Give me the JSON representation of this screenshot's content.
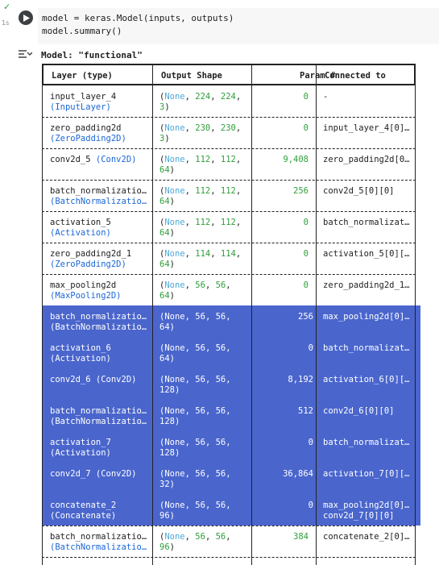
{
  "cell": {
    "status": "✓",
    "exec_time": "1s",
    "code_lines": [
      "model = keras.Model(inputs, outputs)",
      "model.summary()"
    ]
  },
  "output": {
    "title": "Model: \"functional\""
  },
  "table": {
    "headers": [
      "Layer (type)",
      "Output Shape",
      "Param #",
      "Connected to"
    ],
    "rows": [
      {
        "name": "input_layer_4",
        "type": "(InputLayer)",
        "shape": [
          "(None, 224, 224,",
          "3)"
        ],
        "params": "0",
        "conn": [
          "-"
        ],
        "selected": false
      },
      {
        "name": "zero_padding2d",
        "type": "(ZeroPadding2D)",
        "shape": [
          "(None, 230, 230,",
          "3)"
        ],
        "params": "0",
        "conn": [
          "input_layer_4[0]…"
        ],
        "selected": false
      },
      {
        "name": "conv2d_5",
        "type": "(Conv2D)",
        "shape": [
          "(None, 112, 112,",
          "64)"
        ],
        "params": "9,408",
        "conn": [
          "zero_padding2d[0…"
        ],
        "selected": false,
        "inline_type": true
      },
      {
        "name": "batch_normalizatio…",
        "type": "(BatchNormalizatio…",
        "shape": [
          "(None, 112, 112,",
          "64)"
        ],
        "params": "256",
        "conn": [
          "conv2d_5[0][0]"
        ],
        "selected": false
      },
      {
        "name": "activation_5",
        "type": "(Activation)",
        "shape": [
          "(None, 112, 112,",
          "64)"
        ],
        "params": "0",
        "conn": [
          "batch_normalizat…"
        ],
        "selected": false
      },
      {
        "name": "zero_padding2d_1",
        "type": "(ZeroPadding2D)",
        "shape": [
          "(None, 114, 114,",
          "64)"
        ],
        "params": "0",
        "conn": [
          "activation_5[0][…"
        ],
        "selected": false
      },
      {
        "name": "max_pooling2d",
        "type": "(MaxPooling2D)",
        "shape": [
          "(None, 56, 56,",
          "64)"
        ],
        "params": "0",
        "conn": [
          "zero_padding2d_1…"
        ],
        "selected": false
      },
      {
        "name": "batch_normalizatio…",
        "type": "(BatchNormalizatio…",
        "shape": [
          "(None, 56, 56,",
          "64)"
        ],
        "params": "256",
        "conn": [
          "max_pooling2d[0]…"
        ],
        "selected": true
      },
      {
        "name": "activation_6",
        "type": "(Activation)",
        "shape": [
          "(None, 56, 56,",
          "64)"
        ],
        "params": "0",
        "conn": [
          "batch_normalizat…"
        ],
        "selected": true
      },
      {
        "name": "conv2d_6",
        "type": "(Conv2D)",
        "shape": [
          "(None, 56, 56,",
          "128)"
        ],
        "params": "8,192",
        "conn": [
          "activation_6[0][…"
        ],
        "selected": true,
        "inline_type": true
      },
      {
        "name": "batch_normalizatio…",
        "type": "(BatchNormalizatio…",
        "shape": [
          "(None, 56, 56,",
          "128)"
        ],
        "params": "512",
        "conn": [
          "conv2d_6[0][0]"
        ],
        "selected": true
      },
      {
        "name": "activation_7",
        "type": "(Activation)",
        "shape": [
          "(None, 56, 56,",
          "128)"
        ],
        "params": "0",
        "conn": [
          "batch_normalizat…"
        ],
        "selected": true
      },
      {
        "name": "conv2d_7",
        "type": "(Conv2D)",
        "shape": [
          "(None, 56, 56,",
          "32)"
        ],
        "params": "36,864",
        "conn": [
          "activation_7[0][…"
        ],
        "selected": true,
        "inline_type": true
      },
      {
        "name": "concatenate_2",
        "type": "(Concatenate)",
        "shape": [
          "(None, 56, 56,",
          "96)"
        ],
        "params": "0",
        "conn": [
          "max_pooling2d[0]…",
          "conv2d_7[0][0]"
        ],
        "selected": true
      },
      {
        "name": "batch_normalizatio…",
        "type": "(BatchNormalizatio…",
        "shape": [
          "(None, 56, 56,",
          "96)"
        ],
        "params": "384",
        "conn": [
          "concatenate_2[0]…"
        ],
        "selected": false
      }
    ]
  },
  "colors": {
    "selection": "#4a66cd",
    "type_blue": "#1a66d6",
    "none_blue": "#4ea8d8",
    "num_green": "#2e9e3a"
  }
}
